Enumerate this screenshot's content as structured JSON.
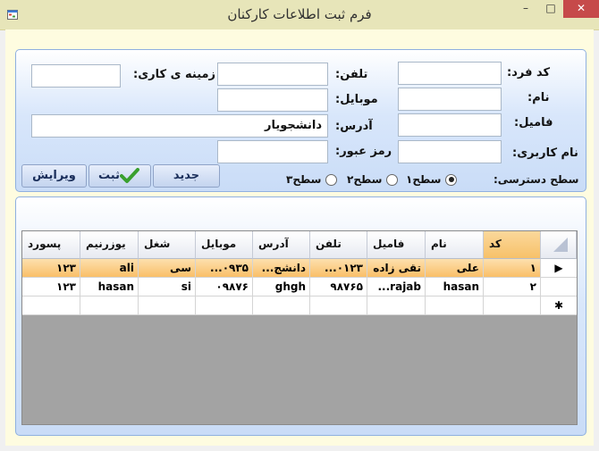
{
  "window": {
    "title": "فرم ثبت اطلاعات کارکنان",
    "min": "–",
    "max": "□",
    "close": "✕",
    "icons": {
      "app": "app-window-icon"
    }
  },
  "form": {
    "labels": {
      "code": "کد فرد:",
      "name": "نام:",
      "family": "فامیل:",
      "username": "نام کاربری:",
      "phone": "تلفن:",
      "mobile": "موبایل:",
      "address": "آدرس:",
      "password": "رمز عبور:",
      "job": "زمینه ی کاری:",
      "access": "سطح دسترسی:"
    },
    "values": {
      "code": "",
      "name": "",
      "family": "",
      "username": "",
      "phone": "",
      "mobile": "",
      "address": "دانشجویار",
      "password": "",
      "job": ""
    },
    "access_levels": [
      "سطح۱",
      "سطح۲",
      "سطح۳"
    ],
    "access_selected": "سطح۱",
    "buttons": {
      "new": "جدید",
      "save": "ثبت",
      "edit": "ویرایش"
    },
    "colors": {
      "accent": "#c9dcf7",
      "selected_row": "#f9bf68"
    }
  },
  "grid": {
    "columns": [
      "کد",
      "نام",
      "فامیل",
      "تلفن",
      "آدرس",
      "موبایل",
      "شغل",
      "یوزرنیم",
      "پسورد"
    ],
    "rows": [
      [
        "۱",
        "علی",
        "تقی زاده",
        "...۰۱۲۳",
        "...دانشج",
        "...۰۹۳۵",
        "سی",
        "ali",
        "۱۲۳"
      ],
      [
        "۲",
        "hasan",
        "...rajab",
        "۹۸۷۶۵",
        "ghgh",
        "۰۹۸۷۶",
        "si",
        "hasan",
        "۱۲۳"
      ]
    ],
    "row_header": {
      "current": "▶",
      "new": "✱"
    }
  }
}
